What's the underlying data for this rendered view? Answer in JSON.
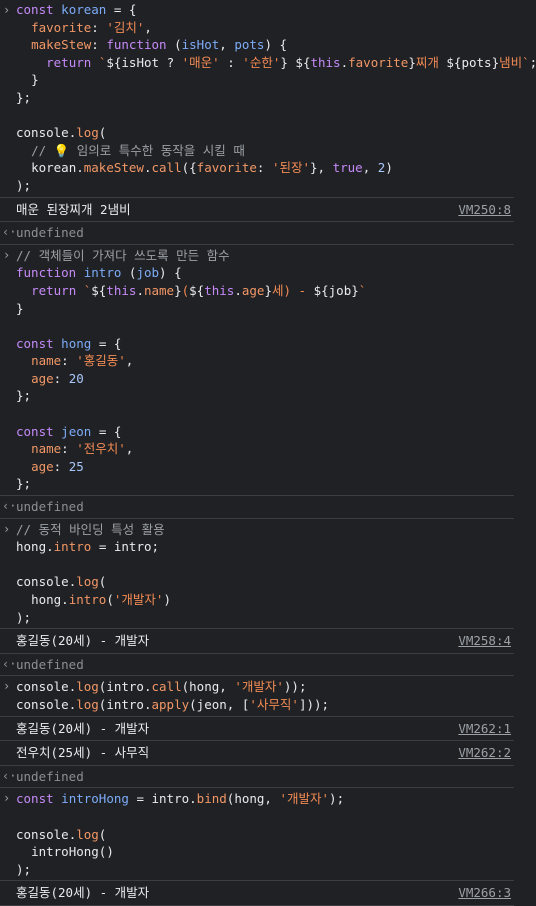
{
  "prompt_icon": "chevron-right-icon",
  "result_icon": "chevron-left-dot-icon",
  "blocks": {
    "b1": [
      "const korean = {",
      "  favorite: '김치',",
      "  makeStew: function (isHot, pots) {",
      "    return `${isHot ? '매운' : '순한'} ${this.favorite}찌개 ${pots}냄비`;",
      "  }",
      "};",
      "",
      "console.log(",
      "  // 💡 임의로 특수한 동작을 시킬 때",
      "  korean.makeStew.call({favorite: '된장'}, true, 2)",
      ");"
    ],
    "b2": [
      "// 객체들이 가져다 쓰도록 만든 함수",
      "function intro (job) {",
      "  return `${this.name}(${this.age}세) - ${job}`",
      "}",
      "",
      "const hong = {",
      "  name: '홍길동',",
      "  age: 20",
      "};",
      "",
      "const jeon = {",
      "  name: '전우치',",
      "  age: 25",
      "};"
    ],
    "b3": [
      "// 동적 바인딩 특성 활용",
      "hong.intro = intro;",
      "",
      "console.log(",
      "  hong.intro('개발자')",
      ");"
    ],
    "b4": [
      "console.log(intro.call(hong, '개발자'));",
      "console.log(intro.apply(jeon, ['사무직']));"
    ],
    "b5": [
      "const introHong = intro.bind(hong, '개발자');",
      "",
      "console.log(",
      "  introHong()",
      ");"
    ]
  },
  "outputs": {
    "o1": {
      "text": "매운 된장찌개 2냄비",
      "source": "VM250:8"
    },
    "o2": {
      "text": "홍길동(20세) - 개발자",
      "source": "VM258:4"
    },
    "o3": {
      "text": "홍길동(20세) - 개발자",
      "source": "VM262:1"
    },
    "o4": {
      "text": "전우치(25세) - 사무직",
      "source": "VM262:2"
    },
    "o5": {
      "text": "홍길동(20세) - 개발자",
      "source": "VM266:3"
    }
  },
  "undefined_label": "undefined"
}
